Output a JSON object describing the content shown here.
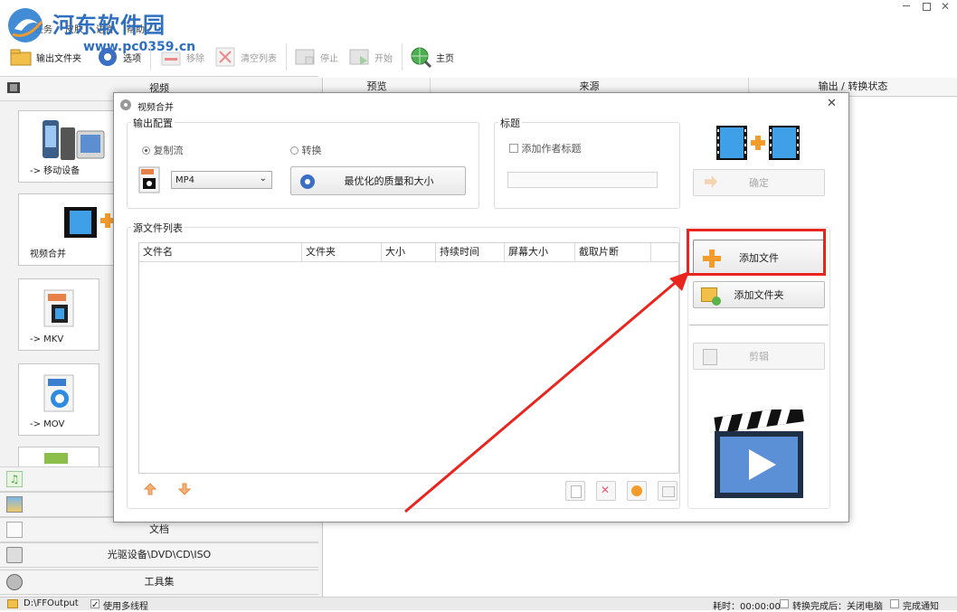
{
  "app": {
    "menu": [
      "任务",
      "皮肤",
      "语言",
      "帮助"
    ],
    "window_controls": [
      "minimize",
      "maximize",
      "close"
    ]
  },
  "watermark": {
    "name": "河东软件园",
    "url": "www.pc0359.cn"
  },
  "toolbar": {
    "output_folder": "输出文件夹",
    "options": "选项",
    "remove": "移除",
    "clear_list": "清空列表",
    "stop": "停止",
    "start": "开始",
    "home": "主页"
  },
  "left_panel": {
    "video_category": "视频",
    "tiles": [
      {
        "label": "-> 移动设备"
      },
      {
        "label": "视频合并"
      },
      {
        "label": "-> MKV"
      },
      {
        "label": "-> MOV"
      }
    ],
    "categories": [
      {
        "label": "",
        "icon": "music-icon"
      },
      {
        "label": "",
        "icon": "picture-icon"
      },
      {
        "label": "文档",
        "icon": "document-icon"
      },
      {
        "label": "光驱设备\\DVD\\CD\\ISO",
        "icon": "disc-drive-icon"
      },
      {
        "label": "工具集",
        "icon": "tools-icon"
      }
    ]
  },
  "right_header": {
    "preview": "预览",
    "source": "来源",
    "output_status": "输出 / 转换状态"
  },
  "status_bar": {
    "output_path": "D:\\FFOutput",
    "multithread": "使用多线程",
    "elapsed": "耗时：00:00:00",
    "after_convert": "转换完成后：关闭电脑",
    "notify": "完成通知"
  },
  "dialog": {
    "title": "视频合并",
    "output_config": {
      "title": "输出配置",
      "copy_stream": "复制流",
      "convert": "转换",
      "format": "MP4",
      "quality_button": "最优化的质量和大小"
    },
    "caption": {
      "title": "标题",
      "add_author_title": "添加作者标题",
      "caption_value": ""
    },
    "ok_button": "确定",
    "source_list": {
      "title": "源文件列表",
      "columns": [
        "文件名",
        "文件夹",
        "大小",
        "持续时间",
        "屏幕大小",
        "截取片断"
      ],
      "rows": []
    },
    "add_file_button": "添加文件",
    "add_folder_button": "添加文件夹",
    "clip_button": "剪辑"
  },
  "colors": {
    "accent": "#2f6fbf",
    "highlight_box": "#e8251f",
    "arrow": "#e8251f",
    "orange": "#f39c2c"
  }
}
